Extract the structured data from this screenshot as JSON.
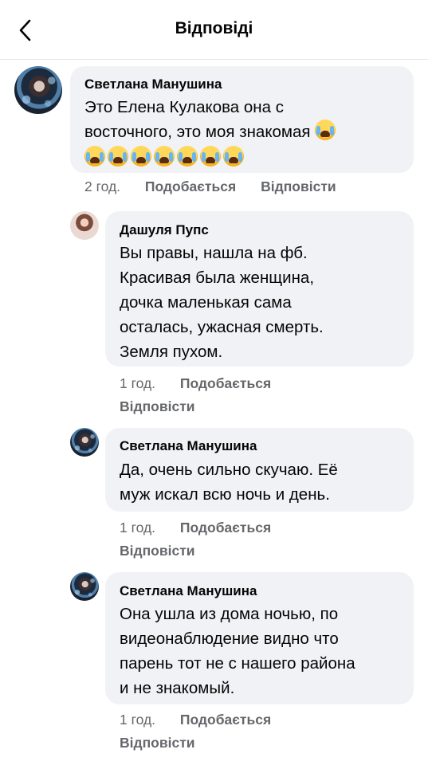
{
  "header": {
    "title": "Відповіді",
    "back_icon": "chevron-left-icon"
  },
  "comments": [
    {
      "author": "Светлана Манушина",
      "lines": [
        "Это Елена Кулакова она с",
        "восточного, это моя знакомая"
      ],
      "emoji": "crying-face-emoji",
      "emoji_count": 8,
      "time": "2 год.",
      "like_label": "Подобається",
      "reply_label": "Відповісти"
    },
    {
      "author": "Дашуля Пупс",
      "lines": [
        "Вы правы, нашла на фб.",
        "Красивая была женщина,",
        "дочка маленькая сама",
        "осталась, ужасная смерть.",
        "Земля пухом."
      ],
      "time": "1 год.",
      "like_label": "Подобається",
      "reply_label": "Відповісти"
    },
    {
      "author": "Светлана Манушина",
      "lines": [
        "Да, очень сильно скучаю. Её",
        "муж искал всю ночь и день."
      ],
      "time": "1 год.",
      "like_label": "Подобається",
      "reply_label": "Відповісти"
    },
    {
      "author": "Светлана Манушина",
      "lines": [
        "Она ушла из дома ночью, по",
        "видеонаблюдение видно что",
        "парень тот не с нашего района",
        "и не знакомый."
      ],
      "time": "1 год.",
      "like_label": "Подобається",
      "reply_label": "Відповісти"
    }
  ]
}
